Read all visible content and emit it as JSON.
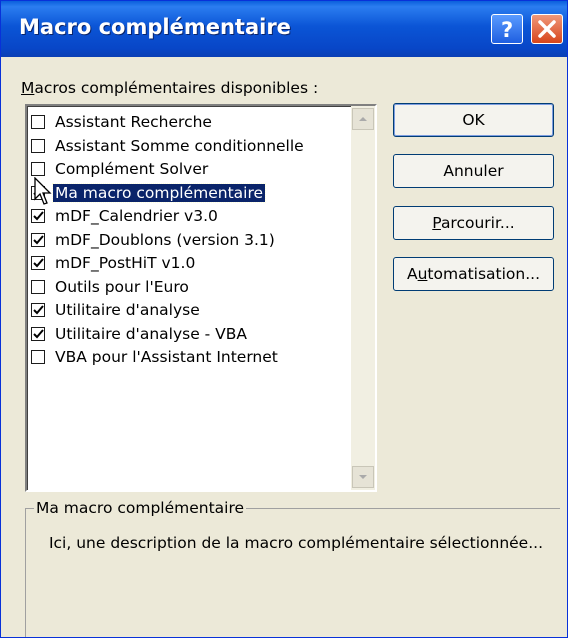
{
  "window": {
    "title": "Macro complémentaire"
  },
  "titlebar_buttons": {
    "help": "?",
    "close": "×"
  },
  "list": {
    "label_accel": "M",
    "label_rest": "acros complémentaires disponibles :",
    "items": [
      {
        "label": "Assistant Recherche",
        "checked": false,
        "selected": false
      },
      {
        "label": "Assistant Somme conditionnelle",
        "checked": false,
        "selected": false
      },
      {
        "label": "Complément Solver",
        "checked": false,
        "selected": false
      },
      {
        "label": "Ma macro complémentaire",
        "checked": true,
        "selected": true
      },
      {
        "label": "mDF_Calendrier v3.0",
        "checked": true,
        "selected": false
      },
      {
        "label": "mDF_Doublons (version 3.1)",
        "checked": true,
        "selected": false
      },
      {
        "label": "mDF_PostHiT v1.0",
        "checked": true,
        "selected": false
      },
      {
        "label": "Outils pour l'Euro",
        "checked": false,
        "selected": false
      },
      {
        "label": "Utilitaire d'analyse",
        "checked": true,
        "selected": false
      },
      {
        "label": "Utilitaire d'analyse - VBA",
        "checked": true,
        "selected": false
      },
      {
        "label": "VBA pour l'Assistant Internet",
        "checked": false,
        "selected": false
      }
    ]
  },
  "buttons": {
    "ok": "OK",
    "cancel": "Annuler",
    "browse_accel": "P",
    "browse_rest": "arcourir...",
    "auto_pre": "A",
    "auto_accel": "u",
    "auto_rest": "tomatisation..."
  },
  "description": {
    "title": "Ma macro complémentaire",
    "text": "Ici, une description de la macro complémentaire sélectionnée..."
  },
  "colors": {
    "titlebar": "#0a52d4",
    "selection": "#0a246a",
    "dialog_bg": "#ece9d8"
  }
}
